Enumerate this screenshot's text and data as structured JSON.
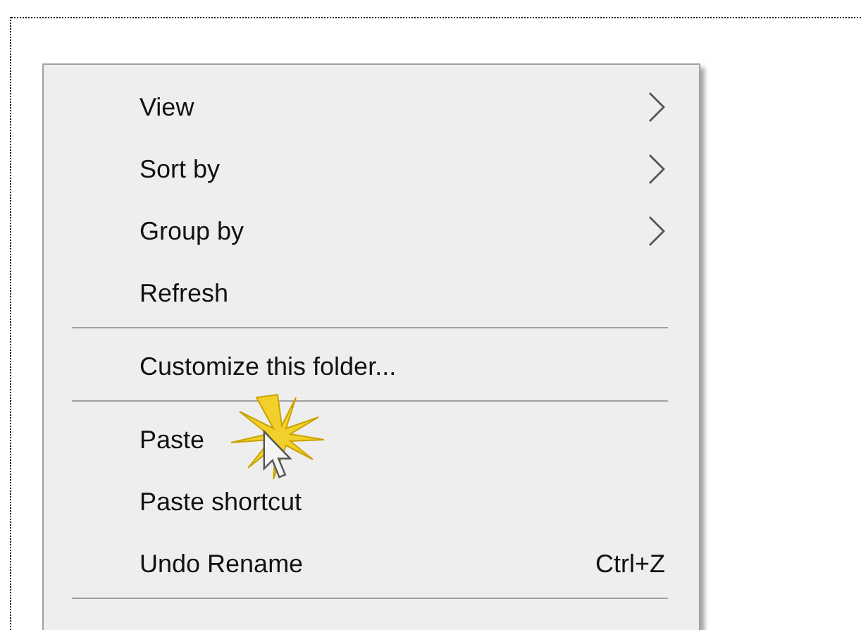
{
  "context_menu": {
    "items": [
      {
        "kind": "submenu",
        "label": "View"
      },
      {
        "kind": "submenu",
        "label": "Sort by"
      },
      {
        "kind": "submenu",
        "label": "Group by"
      },
      {
        "kind": "command",
        "label": "Refresh"
      },
      {
        "kind": "separator"
      },
      {
        "kind": "command",
        "label": "Customize this folder..."
      },
      {
        "kind": "separator"
      },
      {
        "kind": "command",
        "label": "Paste"
      },
      {
        "kind": "command",
        "label": "Paste shortcut"
      },
      {
        "kind": "command",
        "label": "Undo Rename",
        "shortcut": "Ctrl+Z"
      },
      {
        "kind": "separator"
      }
    ]
  }
}
